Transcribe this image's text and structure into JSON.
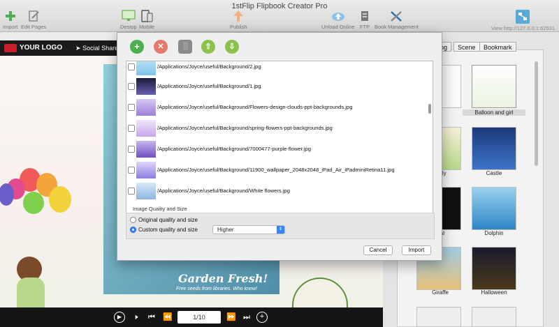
{
  "window": {
    "title": "1stFlip Flipbook Creator Pro"
  },
  "toolbar": {
    "import": "Import",
    "edit_pages": "Edit Pages",
    "desktop": "Destop",
    "mobile": "Mobile",
    "publish": "Publish",
    "unload_online": "Unload Online",
    "ftp": "FTP",
    "book_management": "Book Management",
    "view_url": "View http://127.0.0.1:62531"
  },
  "flipbook": {
    "logo": "YOUR LOGO",
    "social_share": "Social Share",
    "cover_headline": "Garden Fresh!",
    "cover_subline": "Free seeds from libraries. Who knew!",
    "page_indicator": "1/10"
  },
  "right_panel": {
    "tabs": [
      "ng",
      "Scene",
      "Bookmark"
    ],
    "thumbnails": [
      {
        "label": ""
      },
      {
        "label": "Balloon and girl"
      },
      {
        "label": "terfly"
      },
      {
        "label": "Castle"
      },
      {
        "label": "ical"
      },
      {
        "label": "Dolphin"
      },
      {
        "label": "Giraffe"
      },
      {
        "label": "Halloween"
      }
    ]
  },
  "dialog": {
    "files": [
      "/Applications/Joyce/useful/Background/2.jpg",
      "/Applications/Joyce/useful/Background/1.jpg",
      "/Applications/Joyce/useful/Background/Flowers-design-clouds-ppt-backgrounds.jpg",
      "/Applications/Joyce/useful/Background/spring-flowers-ppt-backgrounds.jpg",
      "/Applications/Joyce/useful/Background/7000477-purple-flower.jpg",
      "/Applications/Joyce/useful/Background/11900_wallpaper_2048x2048_iPad_Air_iPadminiRetina11.jpg",
      "/Applications/Joyce/useful/Background/White flowers.jpg"
    ],
    "quality_section_label": "Image Quality and Size",
    "option_original": "Original quality and size",
    "option_custom": "Custom quality and size",
    "quality_value": "Higher",
    "cancel": "Cancel",
    "import": "Import"
  },
  "colors": {
    "accent": "#3b82f6",
    "add_green": "#4caf50",
    "delete_red": "#e57a6a"
  }
}
